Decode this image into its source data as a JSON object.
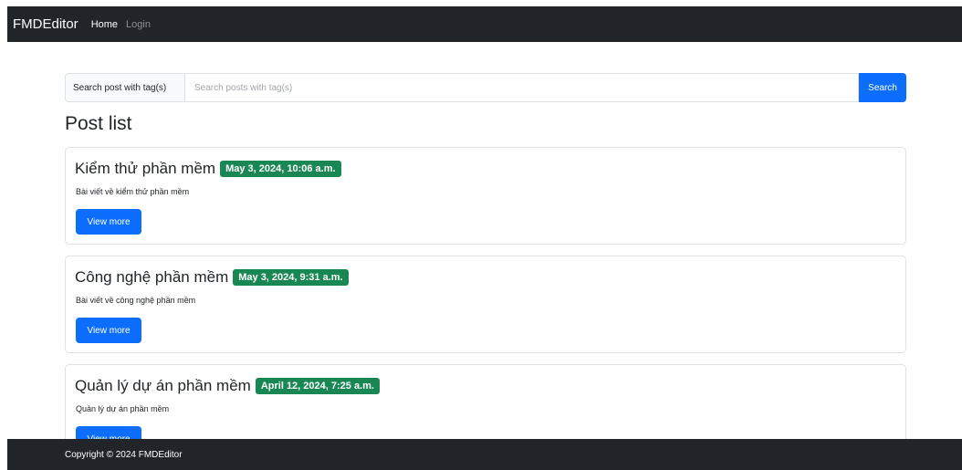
{
  "navbar": {
    "brand": "FMDEditor",
    "links": [
      {
        "label": "Home"
      },
      {
        "label": "Login"
      }
    ]
  },
  "search": {
    "label": "Search post with tag(s)",
    "placeholder": "Search posts with tag(s)",
    "button_label": "Search"
  },
  "post_list": {
    "title": "Post list",
    "posts": [
      {
        "title": "Kiểm thử phần mềm",
        "date": "May 3, 2024, 10:06 a.m.",
        "description": "Bài viết về kiểm thử phần mềm",
        "button_label": "View more"
      },
      {
        "title": "Công nghệ phần mềm",
        "date": "May 3, 2024, 9:31 a.m.",
        "description": "Bài viết về công nghệ phần mềm",
        "button_label": "View more"
      },
      {
        "title": "Quản lý dự án phần mềm",
        "date": "April 12, 2024, 7:25 a.m.",
        "description": "Quản lý dự án phần mềm",
        "button_label": "View more"
      }
    ]
  },
  "footer": {
    "text": "Copyright © 2024 FMDEditor"
  },
  "colors": {
    "navbar_bg": "#212529",
    "primary": "#0d6efd",
    "date_badge": "#198754"
  }
}
